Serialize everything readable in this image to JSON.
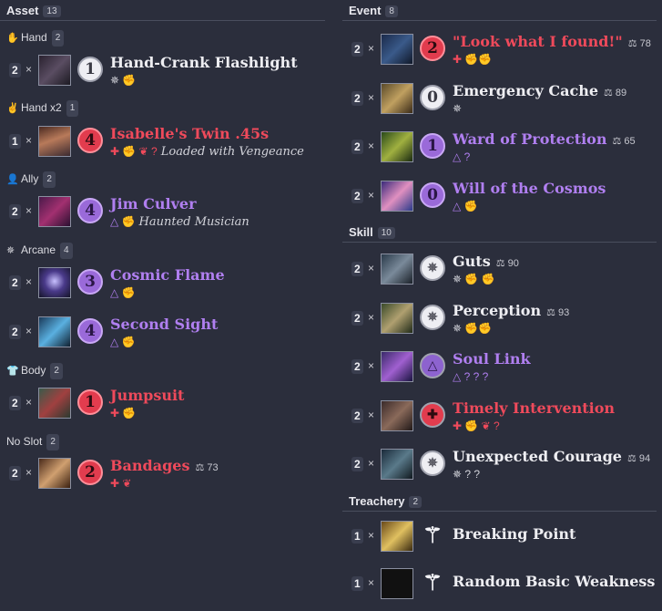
{
  "asset": {
    "title": "Asset",
    "count": "13",
    "slots": [
      {
        "label": "Hand",
        "count": "2",
        "icon": "hand-icon",
        "glyph": "✋"
      },
      {
        "label": "Hand x2",
        "count": "1",
        "icon": "two-hands-icon",
        "glyph": "✌"
      },
      {
        "label": "Ally",
        "count": "2",
        "icon": "ally-icon",
        "glyph": "👤"
      },
      {
        "label": "Arcane",
        "count": "4",
        "icon": "arcane-icon",
        "glyph": "✵"
      },
      {
        "label": "Body",
        "count": "2",
        "icon": "body-icon",
        "glyph": "👕"
      },
      {
        "label": "No Slot",
        "count": "2",
        "icon": "",
        "glyph": ""
      }
    ],
    "cards": [
      {
        "qty": "2",
        "times": "×",
        "cost": "1",
        "name": "Hand-Crank Flashlight",
        "xp": "",
        "icons": "✵ ✊",
        "subtitle": ""
      },
      {
        "qty": "1",
        "times": "×",
        "cost": "4",
        "name": "Isabelle's Twin .45s",
        "xp": "",
        "icons": "✚ ✊ ❦ ?",
        "subtitle": "Loaded with Vengeance"
      },
      {
        "qty": "2",
        "times": "×",
        "cost": "4",
        "name": "Jim Culver",
        "xp": "",
        "icons": "△ ✊",
        "subtitle": "Haunted Musician"
      },
      {
        "qty": "2",
        "times": "×",
        "cost": "3",
        "name": "Cosmic Flame",
        "xp": "",
        "icons": "△ ✊",
        "subtitle": ""
      },
      {
        "qty": "2",
        "times": "×",
        "cost": "4",
        "name": "Second Sight",
        "xp": "",
        "icons": "△ ✊",
        "subtitle": ""
      },
      {
        "qty": "2",
        "times": "×",
        "cost": "1",
        "name": "Jumpsuit",
        "xp": "",
        "icons": "✚ ✊",
        "subtitle": ""
      },
      {
        "qty": "2",
        "times": "×",
        "cost": "2",
        "name": "Bandages",
        "xp": "73",
        "icons": "✚ ❦",
        "subtitle": ""
      }
    ]
  },
  "event": {
    "title": "Event",
    "count": "8",
    "cards": [
      {
        "qty": "2",
        "times": "×",
        "cost": "2",
        "name": "\"Look what I found!\"",
        "xp": "78",
        "icons": "✚ ✊✊"
      },
      {
        "qty": "2",
        "times": "×",
        "cost": "0",
        "name": "Emergency Cache",
        "xp": "89",
        "icons": "✵"
      },
      {
        "qty": "2",
        "times": "×",
        "cost": "1",
        "name": "Ward of Protection",
        "xp": "65",
        "icons": "△ ?"
      },
      {
        "qty": "2",
        "times": "×",
        "cost": "0",
        "name": "Will of the Cosmos",
        "xp": "",
        "icons": "△ ✊"
      }
    ]
  },
  "skill": {
    "title": "Skill",
    "count": "10",
    "cards": [
      {
        "qty": "2",
        "times": "×",
        "cost": "✵",
        "name": "Guts",
        "xp": "90",
        "icons": "✵ ✊ ✊"
      },
      {
        "qty": "2",
        "times": "×",
        "cost": "✵",
        "name": "Perception",
        "xp": "93",
        "icons": "✵ ✊✊"
      },
      {
        "qty": "2",
        "times": "×",
        "cost": "△",
        "name": "Soul Link",
        "xp": "",
        "icons": "△ ? ? ?"
      },
      {
        "qty": "2",
        "times": "×",
        "cost": "✚",
        "name": "Timely Intervention",
        "xp": "",
        "icons": "✚ ✊ ❦ ?"
      },
      {
        "qty": "2",
        "times": "×",
        "cost": "✵",
        "name": "Unexpected Courage",
        "xp": "94",
        "icons": "✵ ? ?"
      }
    ]
  },
  "treachery": {
    "title": "Treachery",
    "count": "2",
    "cards": [
      {
        "qty": "1",
        "times": "×",
        "cost": "⚚",
        "name": "Breaking Point",
        "xp": ""
      },
      {
        "qty": "1",
        "times": "×",
        "cost": "⚚",
        "name": "Random Basic Weakness",
        "xp": ""
      }
    ]
  },
  "colors": {
    "background": "#2b2e3c",
    "guardian": "#ef4a5b",
    "mystic": "#b07ff0",
    "neutral": "#eeeef2"
  }
}
